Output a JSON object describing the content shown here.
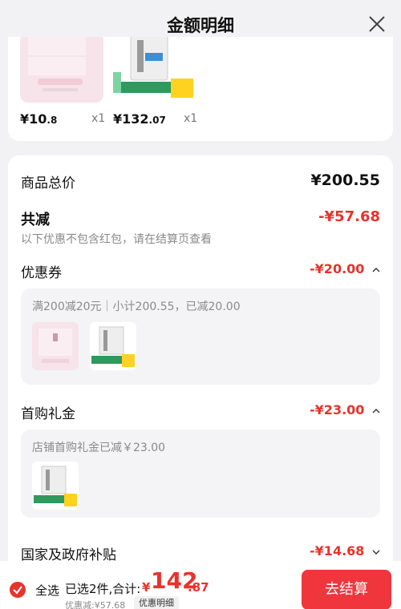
{
  "header": {
    "title": "金额明细"
  },
  "products": [
    {
      "price_int": "¥10",
      "price_dec": ".8",
      "qty": "x1"
    },
    {
      "price_int": "¥132",
      "price_dec": ".07",
      "qty": "x1"
    }
  ],
  "summary": {
    "total_label": "商品总价",
    "total_value": "¥200.55",
    "reduce_label": "共减",
    "reduce_value": "-¥57.68",
    "note": "以下优惠不包含红包，请在结算页查看"
  },
  "coupon": {
    "label": "优惠券",
    "value": "-¥20.00",
    "detail": "满200减20元｜小计200.55，已减20.00"
  },
  "first_gift": {
    "label": "首购礼金",
    "value": "-¥23.00",
    "detail": "店铺首购礼金已减￥23.00"
  },
  "subsidy": {
    "label": "国家及政府补贴",
    "value": "-¥14.68"
  },
  "bottom": {
    "select_all": "全选",
    "selected": "已选2件,合计:",
    "yen": "¥",
    "total_int": "142",
    "total_dec": ".87",
    "discount": "优惠减:¥57.68",
    "detail_link": "优惠明细",
    "checkout": "去结算"
  },
  "colors": {
    "accent": "#e8332b",
    "button": "#f0353c"
  }
}
